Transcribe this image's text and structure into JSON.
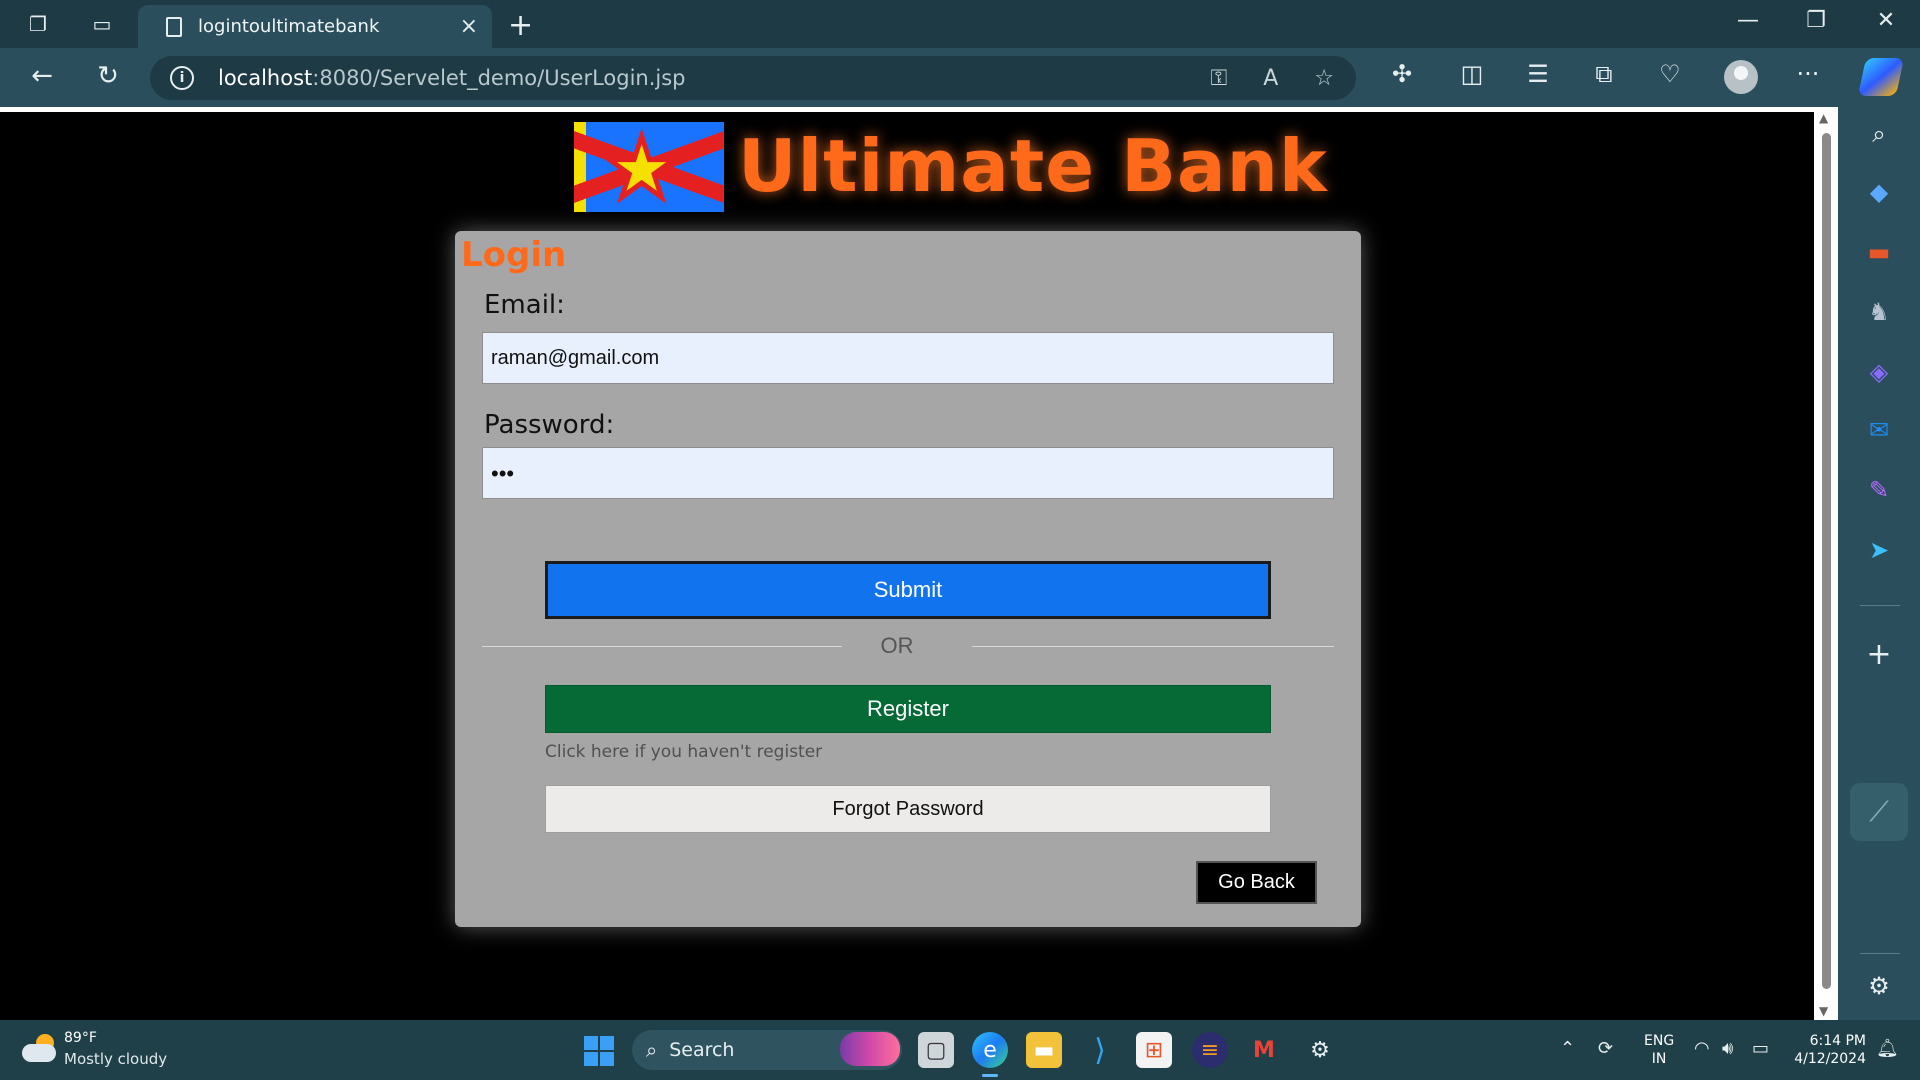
{
  "browser": {
    "tab_title": "logintoultimatebank",
    "url_host": "localhost",
    "url_path": ":8080/Servelet_demo/UserLogin.jsp"
  },
  "page": {
    "brand": "Ultimate Bank",
    "login_title": "Login",
    "email_label": "Email:",
    "email_value": "raman@gmail.com",
    "password_label": "Password:",
    "password_value": "•••",
    "submit_label": "Submit",
    "or_text": "OR",
    "register_label": "Register",
    "register_hint": "Click here if you haven't register",
    "forgot_label": "Forgot Password",
    "back_label": "Go Back"
  },
  "colors": {
    "brand_orange": "#ff6a1a",
    "submit_blue": "#1273ef",
    "register_green": "#066a37",
    "card_gray": "#a6a6a6"
  },
  "taskbar": {
    "temperature": "89°F",
    "weather": "Mostly cloudy",
    "search_label": "Search",
    "lang_top": "ENG",
    "lang_bottom": "IN",
    "time": "6:14 PM",
    "date": "4/12/2024"
  }
}
